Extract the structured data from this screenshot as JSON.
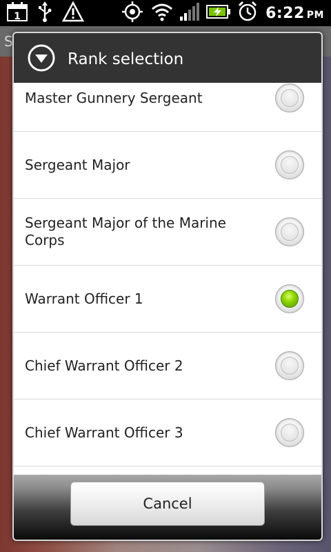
{
  "status_bar": {
    "calendar_day": "1",
    "time": "6:22",
    "ampm": "PM",
    "icons": [
      "calendar-icon",
      "usb-icon",
      "warning-icon",
      "gps-icon",
      "wifi-icon",
      "signal-icon",
      "battery-charging-icon",
      "alarm-icon"
    ]
  },
  "background_app": {
    "title_fragment": "S"
  },
  "dialog": {
    "title": "Rank selection",
    "header_icon": "chevron-down-circle-icon",
    "options": [
      {
        "label": "Master Gunnery Sergeant",
        "selected": false
      },
      {
        "label": "Sergeant Major",
        "selected": false
      },
      {
        "label": "Sergeant Major of the Marine Corps",
        "selected": false
      },
      {
        "label": "Warrant Officer 1",
        "selected": true
      },
      {
        "label": "Chief Warrant Officer 2",
        "selected": false
      },
      {
        "label": "Chief Warrant Officer 3",
        "selected": false
      }
    ],
    "cancel_label": "Cancel",
    "accent_color": "#8fd400"
  }
}
